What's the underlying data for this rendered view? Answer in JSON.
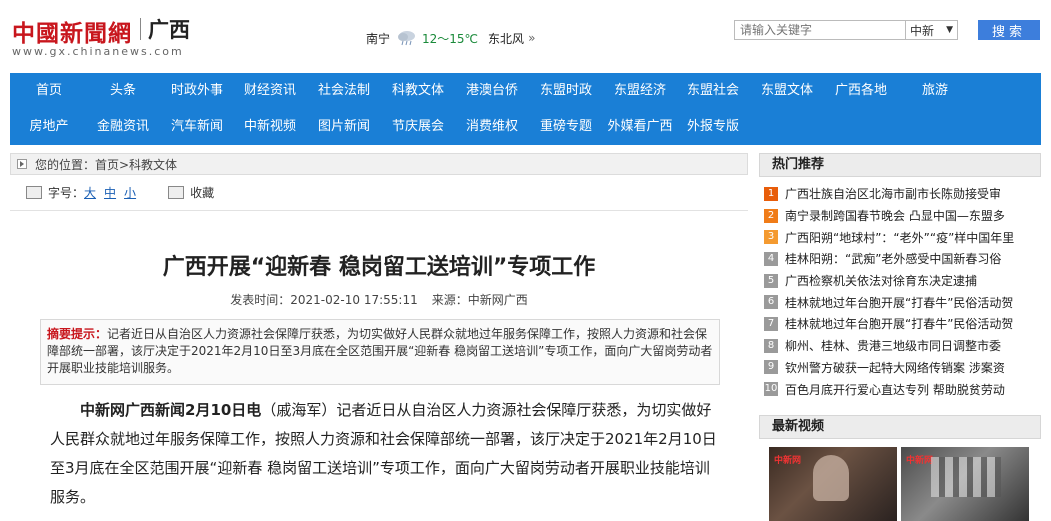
{
  "header": {
    "logo_main": "中國新聞網",
    "logo_region": "广西",
    "logo_domain": "www.gx.chinanews.com",
    "weather": {
      "city": "南宁",
      "icon": "cloud-rain-icon",
      "temperature": "12～15℃",
      "wind": "东北风",
      "more": "»"
    },
    "search": {
      "placeholder": "请输入关键字",
      "select_value": "中新",
      "button_label": "搜索"
    }
  },
  "nav": {
    "row1": [
      "首页",
      "头条",
      "时政外事",
      "财经资讯",
      "社会法制",
      "科教文体",
      "港澳台侨",
      "东盟时政",
      "东盟经济",
      "东盟社会",
      "东盟文体",
      "广西各地",
      "旅游"
    ],
    "row2": [
      "房地产",
      "金融资讯",
      "汽车新闻",
      "中新视频",
      "图片新闻",
      "节庆展会",
      "消费维权",
      "重磅专题",
      "外媒看广西",
      "外报专版"
    ]
  },
  "breadcrumb": {
    "label": "您的位置：首页>科教文体"
  },
  "tools": {
    "font_label": "字号：",
    "font_big": "大",
    "font_mid": "中",
    "font_small": "小",
    "favorite": "收藏"
  },
  "article": {
    "title": "广西开展“迎新春 稳岗留工送培训”专项工作",
    "published_label": "发表时间：2021-02-10 17:55:11",
    "source_label": "来源：中新网广西",
    "summary_label": "摘要提示：",
    "summary_text": "记者近日从自治区人力资源社会保障厅获悉，为切实做好人民群众就地过年服务保障工作，按照人力资源和社会保障部统一部署，该厅决定于2021年2月10日至3月底在全区范围开展“迎新春 稳岗留工送培训”专项工作，面向广大留岗劳动者开展职业技能培训服务。",
    "body_lead": "中新网广西新闻2月10日电",
    "body_text": "（戚海军）记者近日从自治区人力资源社会保障厅获悉，为切实做好人民群众就地过年服务保障工作，按照人力资源和社会保障部统一部署，该厅决定于2021年2月10日至3月底在全区范围开展“迎新春 稳岗留工送培训”专项工作，面向广大留岗劳动者开展职业技能培训服务。"
  },
  "sidebar": {
    "hot_title": "热门推荐",
    "hot_items": [
      {
        "rank": "1",
        "text": "广西壮族自治区北海市副市长陈勋接受审"
      },
      {
        "rank": "2",
        "text": "南宁录制跨国春节晚会 凸显中国—东盟多"
      },
      {
        "rank": "3",
        "text": "广西阳朔“地球村”：“老外”“疫”样中国年里"
      },
      {
        "rank": "4",
        "text": "桂林阳朔：“武痴”老外感受中国新春习俗"
      },
      {
        "rank": "5",
        "text": "广西检察机关依法对徐育东决定逮捕"
      },
      {
        "rank": "6",
        "text": "桂林就地过年台胞开展“打春牛”民俗活动贺"
      },
      {
        "rank": "7",
        "text": "桂林就地过年台胞开展“打春牛”民俗活动贺"
      },
      {
        "rank": "8",
        "text": "柳州、桂林、贵港三地级市同日调整市委"
      },
      {
        "rank": "9",
        "text": "钦州警方破获一起特大网络传销案 涉案资"
      },
      {
        "rank": "10",
        "text": "百色月底开行爱心直达专列 帮助脱贫劳动"
      }
    ],
    "video_title": "最新视频"
  }
}
